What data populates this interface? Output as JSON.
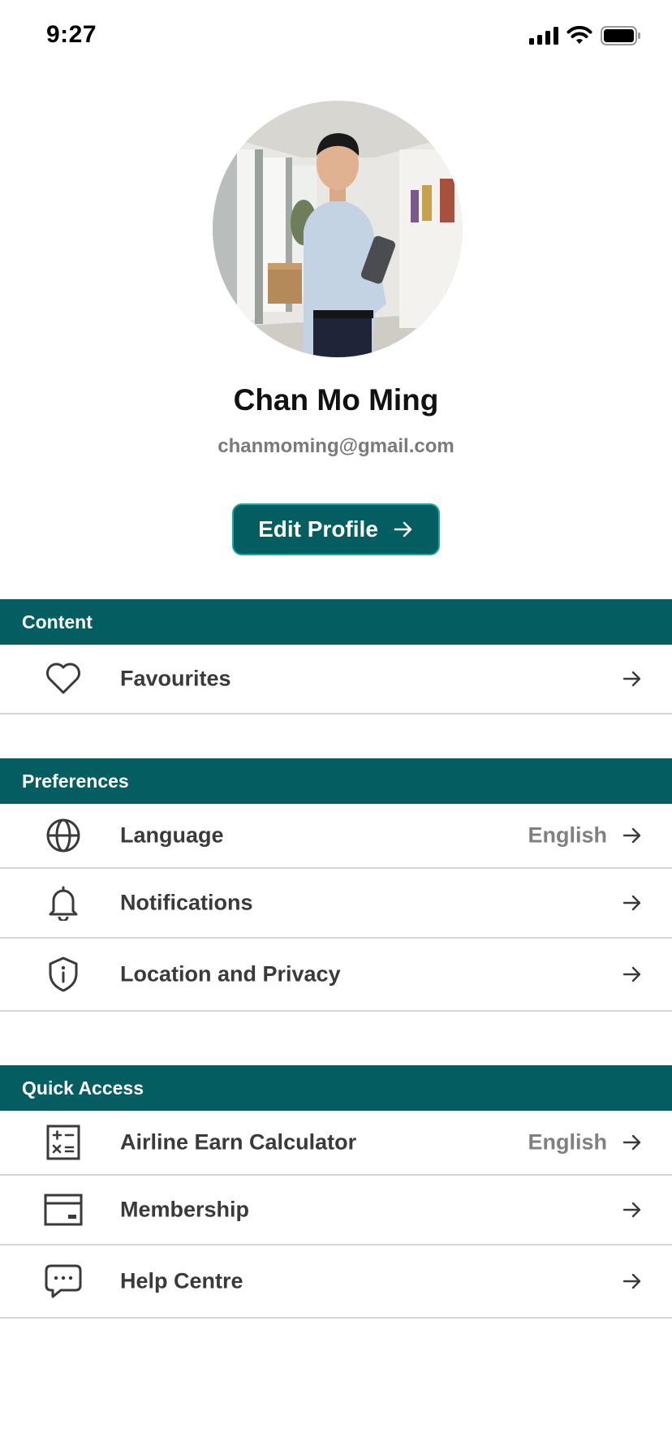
{
  "status_bar": {
    "time": "9:27"
  },
  "profile": {
    "name": "Chan Mo Ming",
    "email": "chanmoming@gmail.com",
    "edit_button": "Edit Profile"
  },
  "sections": {
    "content": {
      "title": "Content",
      "items": [
        {
          "label": "Favourites",
          "icon": "heart-icon"
        }
      ]
    },
    "preferences": {
      "title": "Preferences",
      "items": [
        {
          "label": "Language",
          "value": "English",
          "icon": "globe-icon"
        },
        {
          "label": "Notifications",
          "icon": "bell-icon"
        },
        {
          "label": "Location and Privacy",
          "icon": "shield-info-icon"
        }
      ]
    },
    "quick_access": {
      "title": "Quick Access",
      "items": [
        {
          "label": "Airline Earn Calculator",
          "value": "English",
          "icon": "calculator-icon"
        },
        {
          "label": "Membership",
          "icon": "card-icon"
        },
        {
          "label": "Help Centre",
          "icon": "chat-bubble-icon"
        }
      ]
    }
  },
  "colors": {
    "primary": "#045d60",
    "button_border": "#1aa7a8",
    "divider": "#d6d6d6"
  }
}
